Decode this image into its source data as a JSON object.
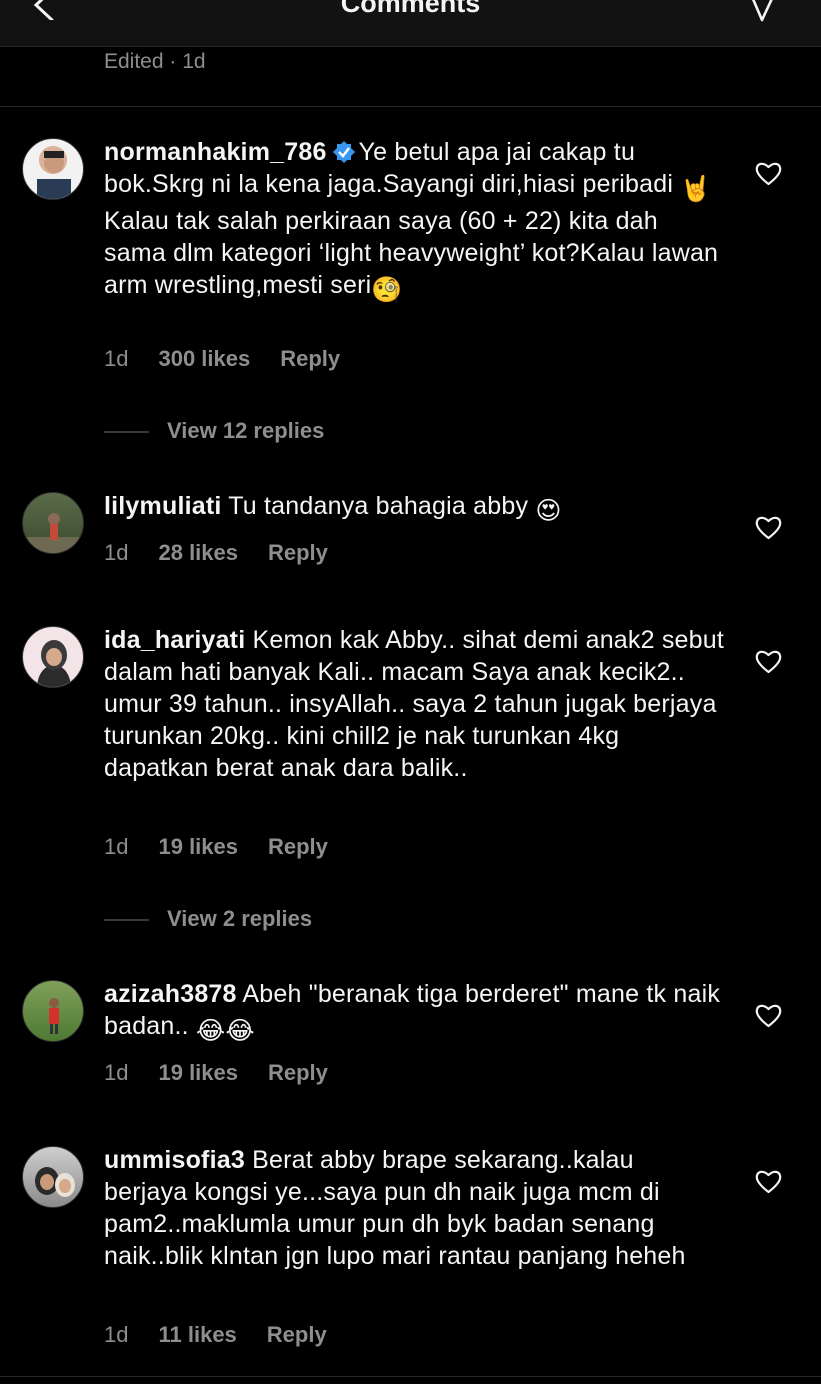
{
  "header": {
    "title": "Comments"
  },
  "top": {
    "edited": "Edited · 1d"
  },
  "comments": [
    {
      "username": "normanhakim_786",
      "verified": true,
      "text_html_parts": [
        "Ye betul apa jai cakap tu bok.Skrg ni la kena jaga.Sayangi diri,hiasi peribadi ",
        "🤘",
        " Kalau tak salah perkiraan saya (60 + 22) kita dah sama dlm kategori ‘light heavyweight’ kot?Kalau lawan arm wrestling,mesti seri",
        "🧐"
      ],
      "time": "1d",
      "likes": "300 likes",
      "reply": "Reply",
      "view_replies": "View 12 replies"
    },
    {
      "username": "lilymuliati",
      "text_html_parts": [
        "Tu tandanya bahagia abby ",
        "😍"
      ],
      "time": "1d",
      "likes": "28 likes",
      "reply": "Reply"
    },
    {
      "username": "ida_hariyati",
      "text_html_parts": [
        "Kemon kak Abby.. sihat demi anak2 sebut dalam hati banyak Kali.. macam Saya anak kecik2.. umur 39 tahun.. insyAllah.. saya 2 tahun jugak berjaya turunkan 20kg.. kini chill2 je nak turunkan 4kg dapatkan berat anak dara balik.."
      ],
      "time": "1d",
      "likes": "19 likes",
      "reply": "Reply",
      "view_replies": "View 2 replies"
    },
    {
      "username": "azizah3878",
      "text_html_parts": [
        "Abeh \"beranak tiga berderet\" mane tk naik badan.. ",
        "😂😂"
      ],
      "time": "1d",
      "likes": "19 likes",
      "reply": "Reply"
    },
    {
      "username": "ummisofia3",
      "text_html_parts": [
        "Berat abby brape sekarang..kalau berjaya kongsi ye...saya pun dh naik juga mcm di pam2..maklumla umur pun dh byk badan senang naik..blik klntan jgn lupo mari rantau panjang heheh"
      ],
      "time": "1d",
      "likes": "11 likes",
      "reply": "Reply"
    }
  ],
  "colors": {
    "background": "#000000",
    "text": "#f5f5f5",
    "secondary": "#8e8e8e",
    "verified": "#3897f0"
  },
  "icons": [
    "back-arrow-icon",
    "send-icon",
    "verified-badge-icon",
    "heart-icon"
  ]
}
